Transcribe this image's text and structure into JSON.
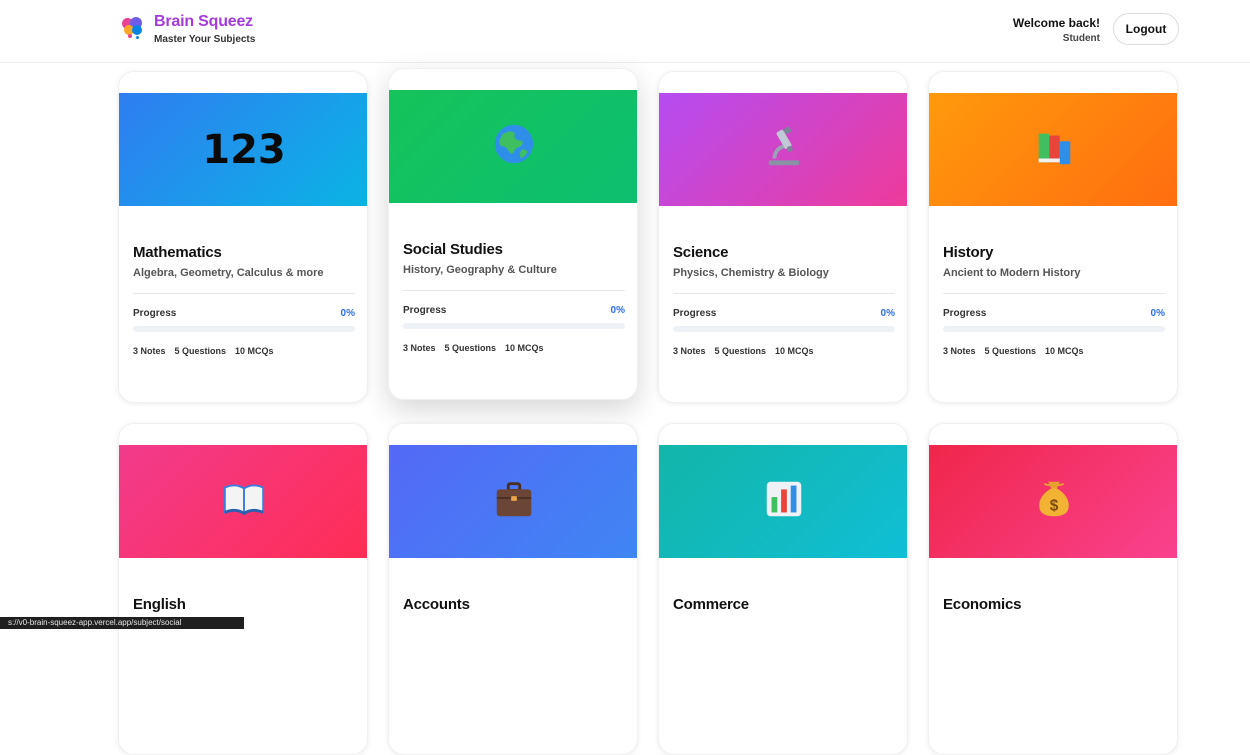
{
  "header": {
    "brand_title": "Brain Squeez",
    "brand_subtitle": "Master Your Subjects",
    "welcome": "Welcome back!",
    "user_name": "Student",
    "logout_label": "Logout"
  },
  "colors": {
    "accent": "#2f6fe4",
    "brand": "#a53bd9"
  },
  "subjects": [
    {
      "banner_text": "123",
      "icon": "",
      "title": "Mathematics",
      "desc": "Algebra, Geometry, Calculus & more",
      "progress_label": "Progress",
      "progress": "0%",
      "notes": "3 Notes",
      "questions": "5 Questions",
      "mcqs": "10 MCQs",
      "gradient": [
        "#2f7df1",
        "#0ab4e4"
      ]
    },
    {
      "banner_text": "",
      "icon": "globe-icon",
      "title": "Social Studies",
      "desc": "History, Geography & Culture",
      "progress_label": "Progress",
      "progress": "0%",
      "notes": "3 Notes",
      "questions": "5 Questions",
      "mcqs": "10 MCQs",
      "gradient": [
        "#15c35a",
        "#0dbf70"
      ]
    },
    {
      "banner_text": "",
      "icon": "microscope-icon",
      "title": "Science",
      "desc": "Physics, Chemistry & Biology",
      "progress_label": "Progress",
      "progress": "0%",
      "notes": "3 Notes",
      "questions": "5 Questions",
      "mcqs": "10 MCQs",
      "gradient": [
        "#b54cf2",
        "#ee3b9a"
      ]
    },
    {
      "banner_text": "",
      "icon": "books-icon",
      "title": "History",
      "desc": "Ancient to Modern History",
      "progress_label": "Progress",
      "progress": "0%",
      "notes": "3 Notes",
      "questions": "5 Questions",
      "mcqs": "10 MCQs",
      "gradient": [
        "#ff9a0c",
        "#ff6d10"
      ]
    },
    {
      "banner_text": "",
      "icon": "open-book-icon",
      "title": "English",
      "desc": "",
      "progress_label": "",
      "progress": "",
      "notes": "",
      "questions": "",
      "mcqs": "",
      "gradient": [
        "#f23b8c",
        "#ff2d55"
      ]
    },
    {
      "banner_text": "",
      "icon": "briefcase-icon",
      "title": "Accounts",
      "desc": "",
      "progress_label": "",
      "progress": "",
      "notes": "",
      "questions": "",
      "mcqs": "",
      "gradient": [
        "#5469f6",
        "#3f86f4"
      ]
    },
    {
      "banner_text": "",
      "icon": "chart-icon",
      "title": "Commerce",
      "desc": "",
      "progress_label": "",
      "progress": "",
      "notes": "",
      "questions": "",
      "mcqs": "",
      "gradient": [
        "#13b5a8",
        "#10bfd6"
      ]
    },
    {
      "banner_text": "",
      "icon": "money-bag-icon",
      "title": "Economics",
      "desc": "",
      "progress_label": "",
      "progress": "",
      "notes": "",
      "questions": "",
      "mcqs": "",
      "gradient": [
        "#f0264a",
        "#f9428f"
      ]
    }
  ],
  "status_bar": {
    "url": "s://v0-brain-squeez-app.vercel.app/subject/social"
  }
}
